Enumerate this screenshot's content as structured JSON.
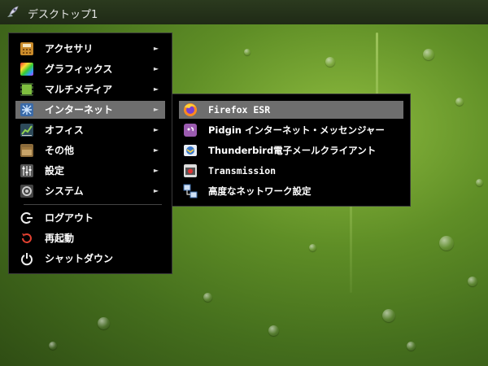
{
  "panel": {
    "title": "デスクトップ1"
  },
  "main_menu": {
    "items": [
      {
        "label": "アクセサリ",
        "icon": "accessories-icon"
      },
      {
        "label": "グラフィックス",
        "icon": "graphics-icon"
      },
      {
        "label": "マルチメディア",
        "icon": "multimedia-icon"
      },
      {
        "label": "インターネット",
        "icon": "internet-icon"
      },
      {
        "label": "オフィス",
        "icon": "office-icon"
      },
      {
        "label": "その他",
        "icon": "other-icon"
      },
      {
        "label": "設定",
        "icon": "settings-icon"
      },
      {
        "label": "システム",
        "icon": "system-icon"
      }
    ],
    "session": [
      {
        "label": "ログアウト",
        "icon": "logout-icon"
      },
      {
        "label": "再起動",
        "icon": "reboot-icon"
      },
      {
        "label": "シャットダウン",
        "icon": "shutdown-icon"
      }
    ],
    "arrow": "►"
  },
  "sub_menu": {
    "items": [
      {
        "label": "Firefox ESR",
        "icon": "firefox-icon"
      },
      {
        "label": "Pidgin インターネット・メッセンジャー",
        "icon": "pidgin-icon"
      },
      {
        "label": "Thunderbird電子メールクライアント",
        "icon": "thunderbird-icon"
      },
      {
        "label": "Transmission",
        "icon": "transmission-icon"
      },
      {
        "label": "高度なネットワーク設定",
        "icon": "network-settings-icon"
      }
    ]
  },
  "colors": {
    "highlight": "#6e6e6e",
    "menu_bg": "#000000",
    "panel_bg": "#232f19"
  }
}
